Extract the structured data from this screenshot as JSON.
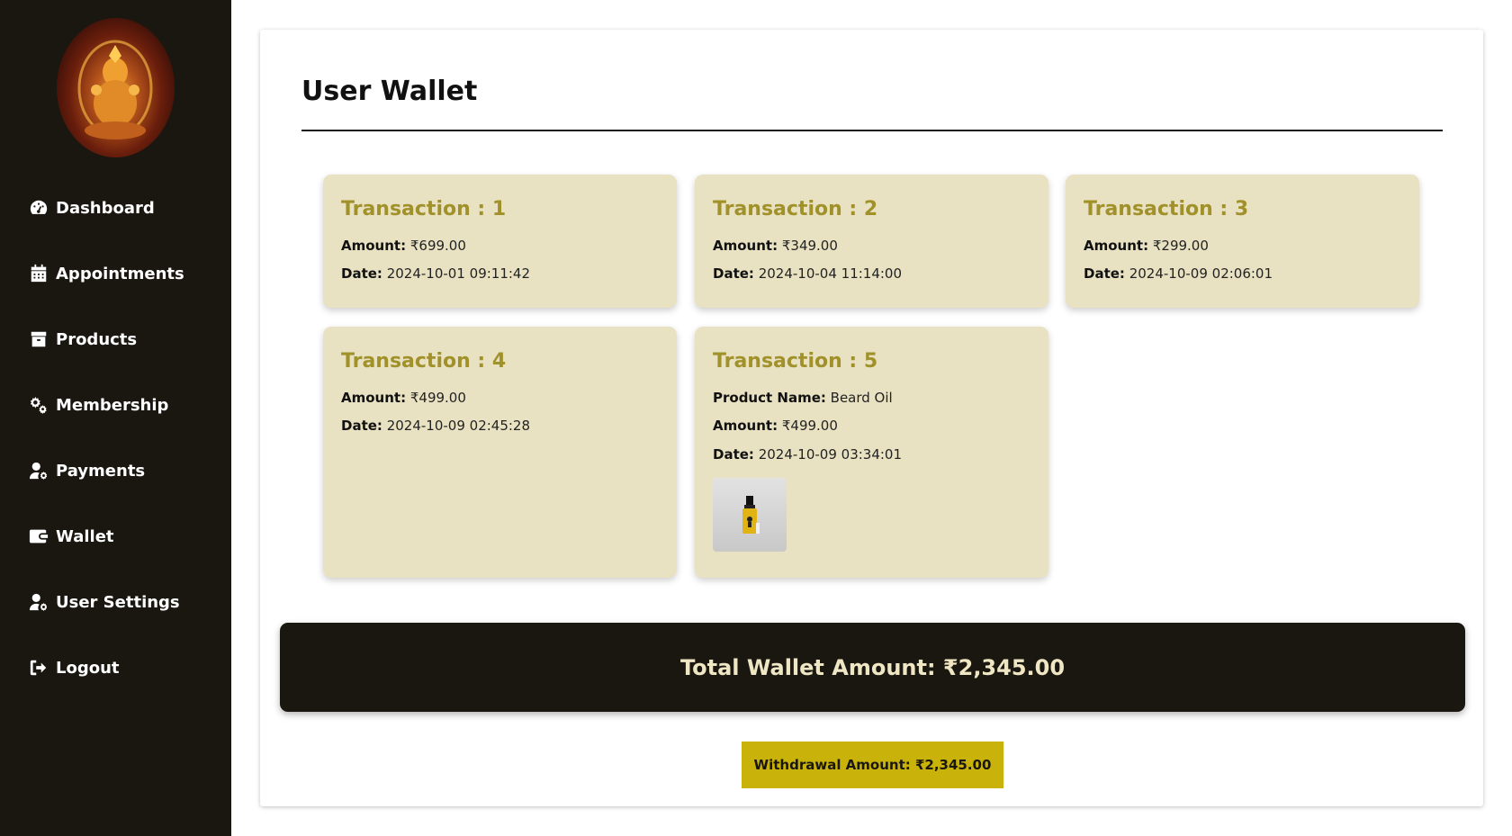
{
  "sidebar": {
    "items": [
      {
        "label": "Dashboard",
        "icon": "dashboard-gauge-icon"
      },
      {
        "label": "Appointments",
        "icon": "calendar-icon"
      },
      {
        "label": "Products",
        "icon": "box-icon"
      },
      {
        "label": "Membership",
        "icon": "gears-icon"
      },
      {
        "label": "Payments",
        "icon": "user-gear-icon"
      },
      {
        "label": "Wallet",
        "icon": "wallet-icon"
      },
      {
        "label": "User Settings",
        "icon": "user-gear-icon"
      },
      {
        "label": "Logout",
        "icon": "logout-icon"
      }
    ]
  },
  "main": {
    "title": "User Wallet",
    "transactions": [
      {
        "title": "Transaction : 1",
        "amount_label": "Amount:",
        "amount": "₹699.00",
        "date_label": "Date:",
        "date": "2024-10-01 09:11:42"
      },
      {
        "title": "Transaction : 2",
        "amount_label": "Amount:",
        "amount": "₹349.00",
        "date_label": "Date:",
        "date": "2024-10-04 11:14:00"
      },
      {
        "title": "Transaction : 3",
        "amount_label": "Amount:",
        "amount": "₹299.00",
        "date_label": "Date:",
        "date": "2024-10-09 02:06:01"
      },
      {
        "title": "Transaction : 4",
        "amount_label": "Amount:",
        "amount": "₹499.00",
        "date_label": "Date:",
        "date": "2024-10-09 02:45:28"
      },
      {
        "title": "Transaction : 5",
        "product_label": "Product Name:",
        "product": "Beard Oil",
        "amount_label": "Amount:",
        "amount": "₹499.00",
        "date_label": "Date:",
        "date": "2024-10-09 03:34:01"
      }
    ],
    "total_label": "Total Wallet Amount: ₹2,345.00",
    "withdraw_label": "Withdrawal Amount: ₹2,345.00"
  },
  "colors": {
    "sidebar_bg": "#1a1710",
    "card_bg": "#e9e2c2",
    "accent_gold": "#a1912a",
    "button_gold": "#c9b30a"
  }
}
